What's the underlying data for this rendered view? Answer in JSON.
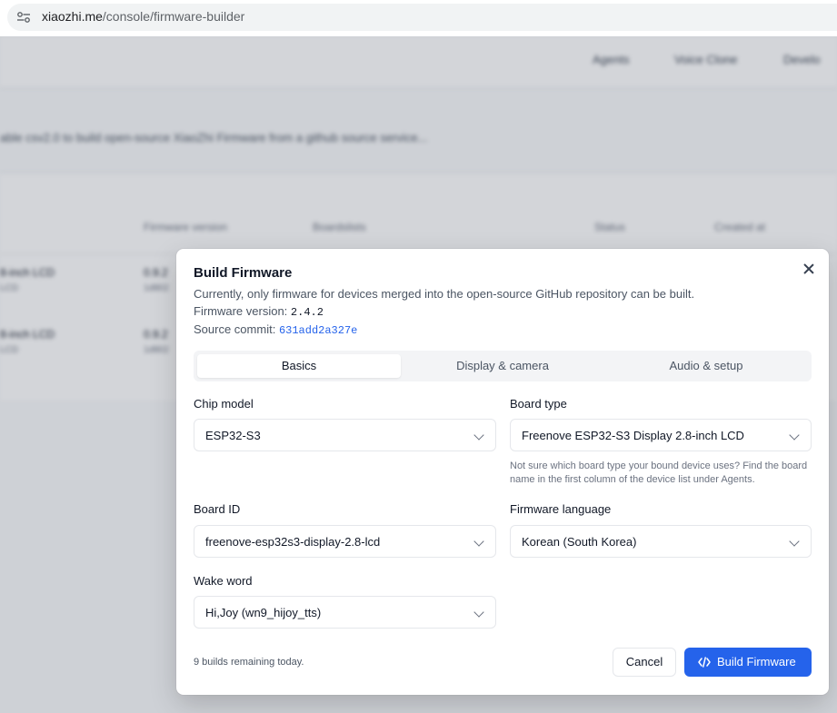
{
  "browser": {
    "url_host": "xiaozhi.me",
    "url_path": "/console/firmware-builder"
  },
  "background": {
    "nav": [
      "Agents",
      "Voice Clone",
      "Develo"
    ],
    "description": "able csv2.0 to build open-source XiaoZhi Firmware from a github source service...",
    "table_headers": [
      "Firmware version",
      "Boardslists",
      "Status",
      "Created at"
    ],
    "rows": [
      {
        "name": "8-inch LCD",
        "sub": "LCD",
        "ver": "0.9.2",
        "ver_sub": "1d802"
      },
      {
        "name": "8-inch LCD",
        "sub": "LCD",
        "ver": "0.9.2",
        "ver_sub": "1d802"
      }
    ]
  },
  "dialog": {
    "title": "Build Firmware",
    "subtitle": "Currently, only firmware for devices merged into the open-source GitHub repository can be built.",
    "version_label": "Firmware version:",
    "version_value": "2.4.2",
    "commit_label": "Source commit:",
    "commit_value": "631add2a327e",
    "tabs": [
      "Basics",
      "Display & camera",
      "Audio & setup"
    ],
    "active_tab": "Basics",
    "fields": {
      "chip_model": {
        "label": "Chip model",
        "value": "ESP32-S3"
      },
      "board_type": {
        "label": "Board type",
        "value": "Freenove ESP32-S3 Display 2.8-inch LCD"
      },
      "board_hint": "Not sure which board type your bound device uses? Find the board name in the first column of the device list under Agents.",
      "board_id": {
        "label": "Board ID",
        "value": "freenove-esp32s3-display-2.8-lcd"
      },
      "firmware_language": {
        "label": "Firmware language",
        "value": "Korean (South Korea)"
      },
      "wake_word": {
        "label": "Wake word",
        "value": "Hi,Joy (wn9_hijoy_tts)"
      }
    },
    "remaining": "9 builds remaining today.",
    "cancel_label": "Cancel",
    "build_label": "Build Firmware",
    "accent_color": "#2563eb"
  }
}
